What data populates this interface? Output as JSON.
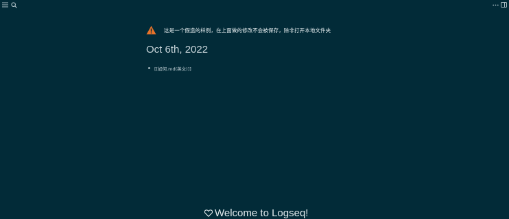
{
  "topbar": {
    "left_icons": [
      "menu-icon",
      "search-icon"
    ],
    "right_icons": [
      "more-icon",
      "sidebar-toggle-icon"
    ]
  },
  "notice": {
    "icon": "warning-icon",
    "icon_color": "#e8732a",
    "text": "这是一个假造的样例，在上面做的修改不会被保存，除非打开本地文件夹"
  },
  "journal": {
    "title": "Oct 6th, 2022",
    "blocks": [
      {
        "text": "[[如何.md(英文)]]"
      }
    ]
  },
  "welcome": {
    "icon": "heart-icon",
    "text": "Welcome to Logseq!"
  },
  "colors": {
    "background": "#022b38",
    "accent_warning": "#e8732a"
  }
}
